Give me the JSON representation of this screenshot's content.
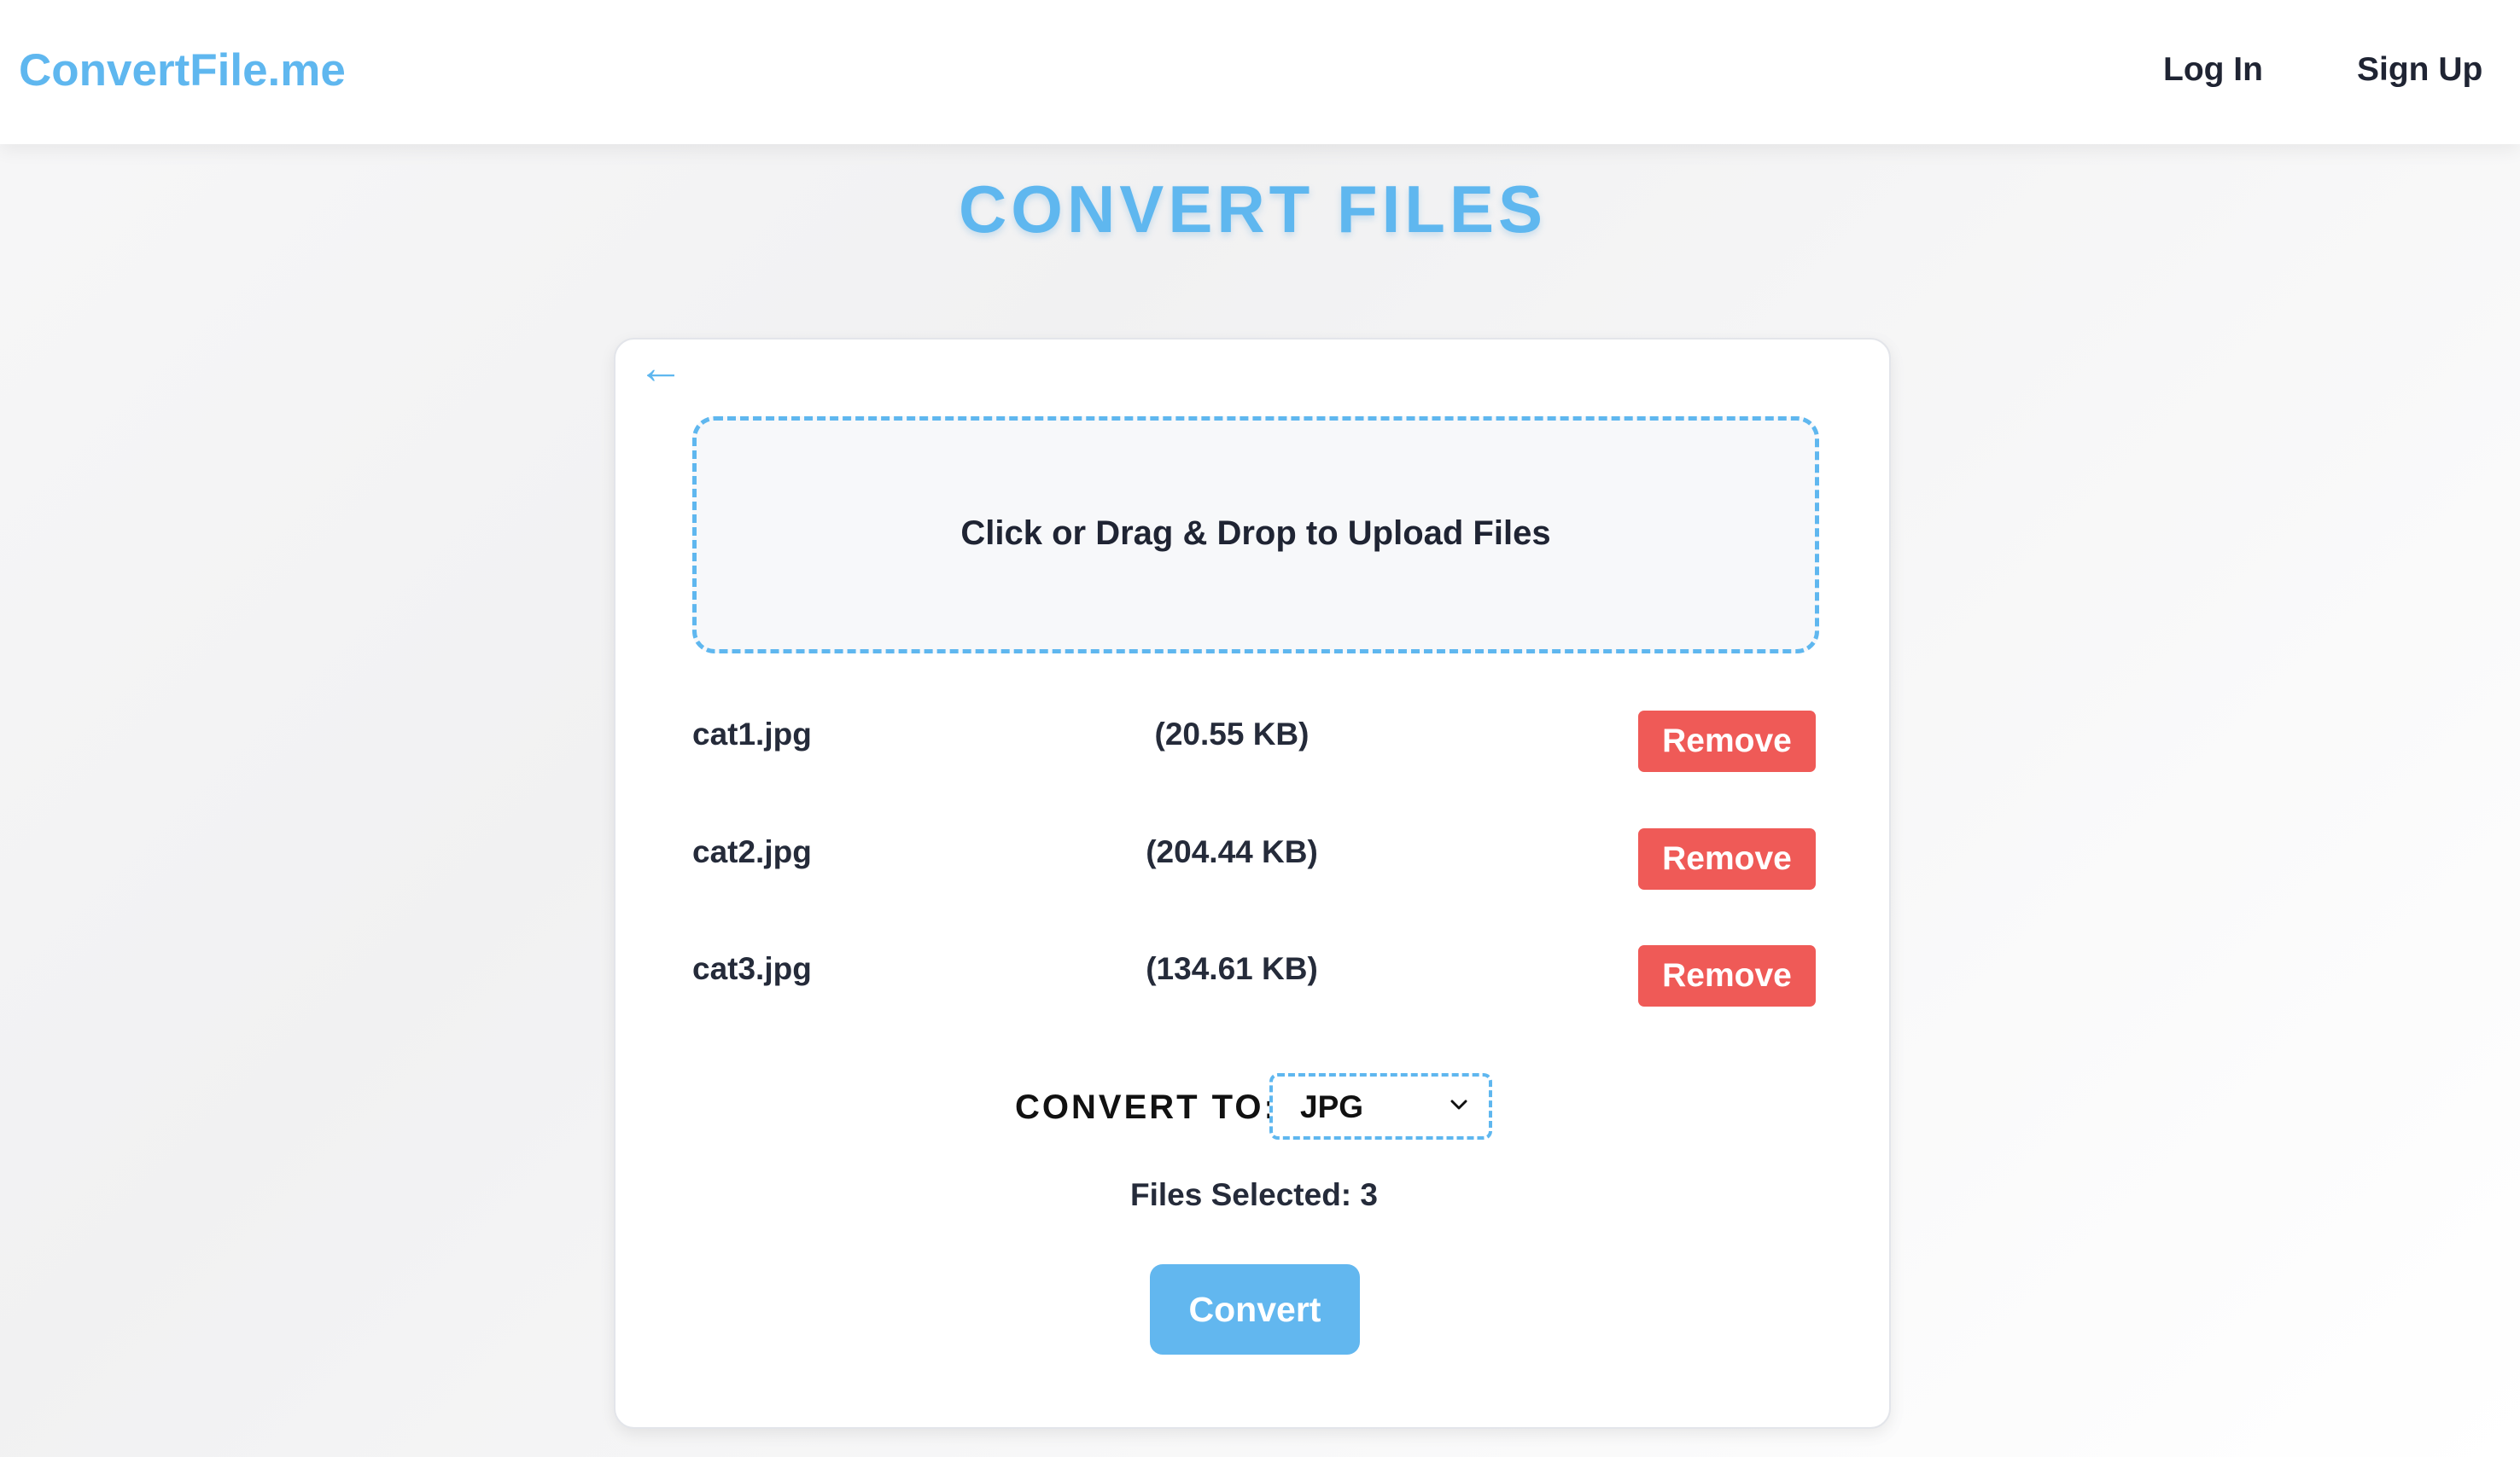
{
  "header": {
    "brand": "ConvertFile.me",
    "nav": {
      "login": "Log In",
      "signup": "Sign Up"
    }
  },
  "page": {
    "title": "CONVERT FILES"
  },
  "card": {
    "back_icon": "left-arrow-icon",
    "upload_text": "Click or Drag & Drop to Upload Files",
    "files": [
      {
        "name": "cat1.jpg",
        "size": "(20.55 KB)",
        "remove_label": "Remove"
      },
      {
        "name": "cat2.jpg",
        "size": "(204.44 KB)",
        "remove_label": "Remove"
      },
      {
        "name": "cat3.jpg",
        "size": "(134.61 KB)",
        "remove_label": "Remove"
      }
    ],
    "convert_to_label": "CONVERT TO:",
    "format_selected": "JPG",
    "files_selected": "Files Selected: 3",
    "convert_label": "Convert"
  },
  "colors": {
    "accent": "#5fb7ef",
    "danger": "#ef5a57",
    "text": "#1f2433"
  }
}
